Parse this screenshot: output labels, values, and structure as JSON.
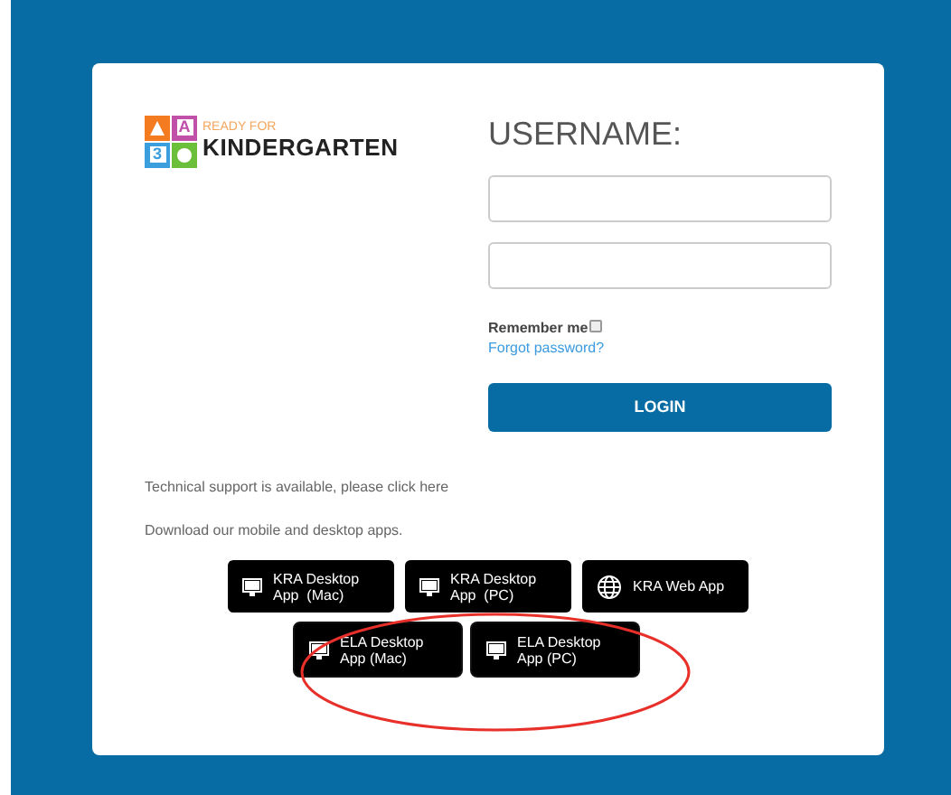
{
  "logo": {
    "tagline": "READY FOR",
    "name": "KINDERGARTEN",
    "tiles": [
      {
        "kind": "triangle",
        "color": "#f47b20"
      },
      {
        "kind": "letter",
        "text": "A",
        "color": "#c050a8"
      },
      {
        "kind": "letter",
        "text": "3",
        "color": "#3a9fdc"
      },
      {
        "kind": "circle",
        "color": "#6cbf3a"
      }
    ]
  },
  "login": {
    "title": "USERNAME:",
    "remember": {
      "label": "Remember me",
      "checked": false
    },
    "forgot": "Forgot password?",
    "button": "LOGIN"
  },
  "support": "Technical support is available, please click here",
  "download": "Download our mobile and desktop apps.",
  "app_rows": [
    [
      {
        "kind": "desktop",
        "label": "KRA Desktop App  (Mac)"
      },
      {
        "kind": "desktop",
        "label": "KRA Desktop App  (PC)"
      },
      {
        "kind": "web",
        "label": "KRA Web App"
      }
    ],
    [
      {
        "kind": "desktop",
        "label": "ELA Desktop App (Mac)",
        "highlighted": true
      },
      {
        "kind": "desktop",
        "label": "ELA Desktop App (PC)",
        "highlighted": true
      }
    ]
  ]
}
